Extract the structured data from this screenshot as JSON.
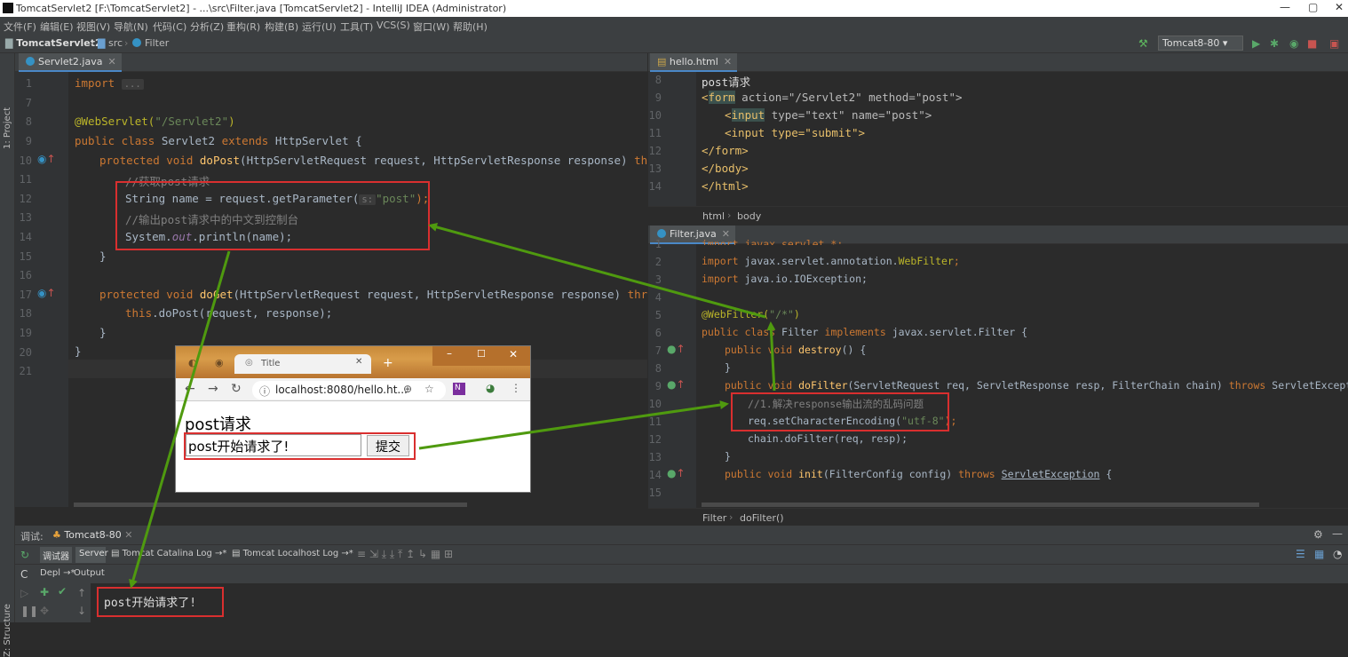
{
  "window": {
    "title": "TomcatServlet2 [F:\\TomcatServlet2] - ...\\src\\Filter.java [TomcatServlet2] - IntelliJ IDEA (Administrator)",
    "controls": [
      "—",
      "▢",
      "✕"
    ]
  },
  "menu": [
    "文件(F)",
    "编辑(E)",
    "视图(V)",
    "导航(N)",
    "代码(C)",
    "分析(Z)",
    "重构(R)",
    "构建(B)",
    "运行(U)",
    "工具(T)",
    "VCS(S)",
    "窗口(W)",
    "帮助(H)"
  ],
  "breadcrumb": [
    "TomcatServlet2",
    "src",
    "Filter"
  ],
  "run_config": "Tomcat8-80 ▾",
  "left_strip": {
    "project": "1: Project",
    "structure": "Z: Structure"
  },
  "left_editor": {
    "tab": "Servlet2.java",
    "line_numbers": [
      "1",
      "7",
      "8",
      "9",
      "10",
      "11",
      "12",
      "13",
      "14",
      "15",
      "16",
      "17",
      "18",
      "19",
      "20",
      "21"
    ],
    "lines": {
      "l1_import": "import",
      "l1_dots": "...",
      "l8_ann": "@WebServlet(",
      "l8_str": "\"/Servlet2\"",
      "l8_end": ")",
      "l9_kw": "public class",
      "l9_name": "Servlet2",
      "l9_ext": "extends",
      "l9_rest": "HttpServlet {",
      "l10_kw": "protected void",
      "l10_fn": "doPost",
      "l10_rest": "(HttpServletRequest request, HttpServletResponse response)",
      "l10_throws": "throws",
      "l11": "//获取post请求",
      "l12_a": "String name = request.getParameter(",
      "l12_hint": "s:",
      "l12_str": "\"post\"",
      "l12_end": ");",
      "l13": "//输出post请求中的中文到控制台",
      "l14_a": "System.",
      "l14_out": "out",
      "l14_b": ".println(name);",
      "l15": "}",
      "l17_kw": "protected void",
      "l17_fn": "doGet",
      "l17_rest": "(HttpServletRequest request, HttpServletResponse response)",
      "l17_throws": "throws",
      "l18_kw": "this",
      "l18_rest": ".doPost(request, response);",
      "l19": "}",
      "l20": "}"
    }
  },
  "html_editor": {
    "tab": "hello.html",
    "line_numbers": [
      "8",
      "9",
      "10",
      "11",
      "12",
      "13",
      "14"
    ],
    "l8": "post请求",
    "l9_open": "<",
    "l9_form": "form",
    "l9_rest": " action=\"/Servlet2\" method=\"post\">",
    "l10_open": "<",
    "l10_input": "input",
    "l10_rest": " type=\"text\" name=\"post\">",
    "l11": "<input type=\"submit\">",
    "l12": "</form>",
    "l13": "</body>",
    "l14": "</html>",
    "crumbs": [
      "html",
      "body"
    ]
  },
  "filter_editor": {
    "tab": "Filter.java",
    "line_numbers": [
      "1",
      "2",
      "3",
      "4",
      "5",
      "6",
      "7",
      "8",
      "9",
      "10",
      "11",
      "12",
      "13",
      "14",
      "15"
    ],
    "l1": "import javax.servlet.*;",
    "l2_kw": "import",
    "l2_rest": "javax.servlet.annotation.",
    "l2_cls": "WebFilter",
    "l2_end": ";",
    "l3_kw": "import",
    "l3_rest": "java.io.IOException;",
    "l5_ann": "@WebFilter(",
    "l5_str": "\"/*\"",
    "l5_end": ")",
    "l6_kw": "public class",
    "l6_name": "Filter",
    "l6_impl": "implements",
    "l6_rest": "javax.servlet.Filter {",
    "l7_kw": "public void",
    "l7_fn": "destroy",
    "l7_rest": "() {",
    "l8": "}",
    "l9_kw": "public void",
    "l9_fn": "doFilter",
    "l9_rest": "(ServletRequest req, ServletResponse resp, FilterChain chain)",
    "l9_throws": "throws",
    "l9_end": "ServletException, IOE",
    "l10": "//1.解决response输出流的乱码问题",
    "l11_a": "req.setCharacterEncoding(",
    "l11_str": "\"utf-8\"",
    "l11_end": ");",
    "l12": "chain.doFilter(req, resp);",
    "l13": "}",
    "l14_kw": "public void",
    "l14_fn": "init",
    "l14_rest": "(FilterConfig config)",
    "l14_throws": "throws",
    "l14_exc": "ServletException",
    "l14_end": "{",
    "crumbs": [
      "Filter",
      "doFilter()"
    ]
  },
  "browser": {
    "tab_title": "Title",
    "url": "localhost:8080/hello.ht...",
    "heading": "post请求",
    "input_value": "post开始请求了!",
    "submit_label": "提交"
  },
  "debug_panel": {
    "label": "调试:",
    "config_tab": "Tomcat8-80",
    "tabs": [
      "调试器",
      "Server",
      "Tomcat Catalina Log",
      "Tomcat Localhost Log"
    ],
    "sub_tabs": [
      "Depl",
      "Output"
    ],
    "output": "post开始请求了!"
  }
}
